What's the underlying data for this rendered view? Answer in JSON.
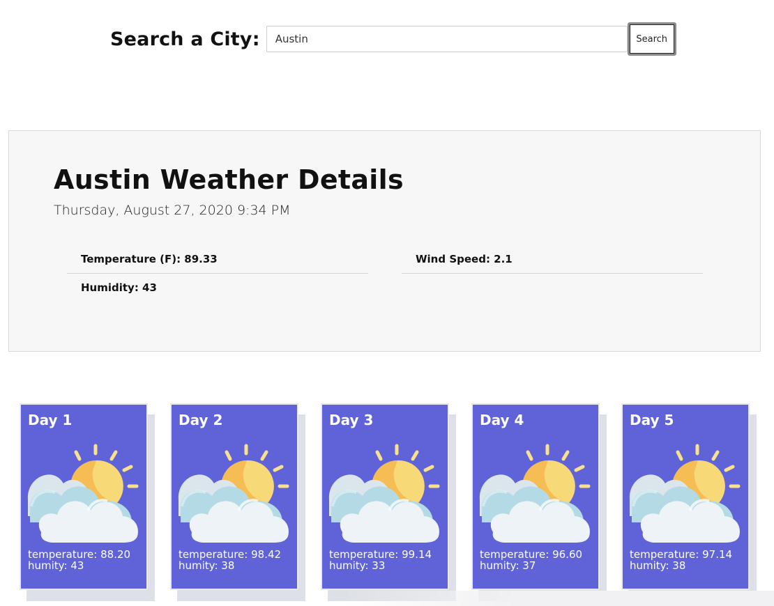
{
  "search": {
    "label": "Search a City:",
    "value": "Austin",
    "button_label": "Search"
  },
  "details": {
    "title": "Austin Weather Details",
    "date": "Thursday, August 27, 2020 9:34 PM",
    "temperature": "Temperature (F): 89.33",
    "wind_speed": "Wind Speed: 2.1",
    "humidity": "Humidity: 43"
  },
  "forecast": [
    {
      "title": "Day 1",
      "temperature": "temperature: 88.20",
      "humidity": "humity: 43",
      "icon": "partly-cloudy-sun-icon"
    },
    {
      "title": "Day 2",
      "temperature": "temperature: 98.42",
      "humidity": "humity: 38",
      "icon": "partly-cloudy-sun-icon"
    },
    {
      "title": "Day 3",
      "temperature": "temperature: 99.14",
      "humidity": "humity: 33",
      "icon": "partly-cloudy-sun-icon"
    },
    {
      "title": "Day 4",
      "temperature": "temperature: 96.60",
      "humidity": "humity: 37",
      "icon": "partly-cloudy-sun-icon"
    },
    {
      "title": "Day 5",
      "temperature": "temperature: 97.14",
      "humidity": "humity: 38",
      "icon": "partly-cloudy-sun-icon"
    }
  ],
  "colors": {
    "card_background": "#6063d8",
    "panel_background": "#f7f7f7",
    "sun": "#f7c04f",
    "cloud": "#eef3f7"
  }
}
